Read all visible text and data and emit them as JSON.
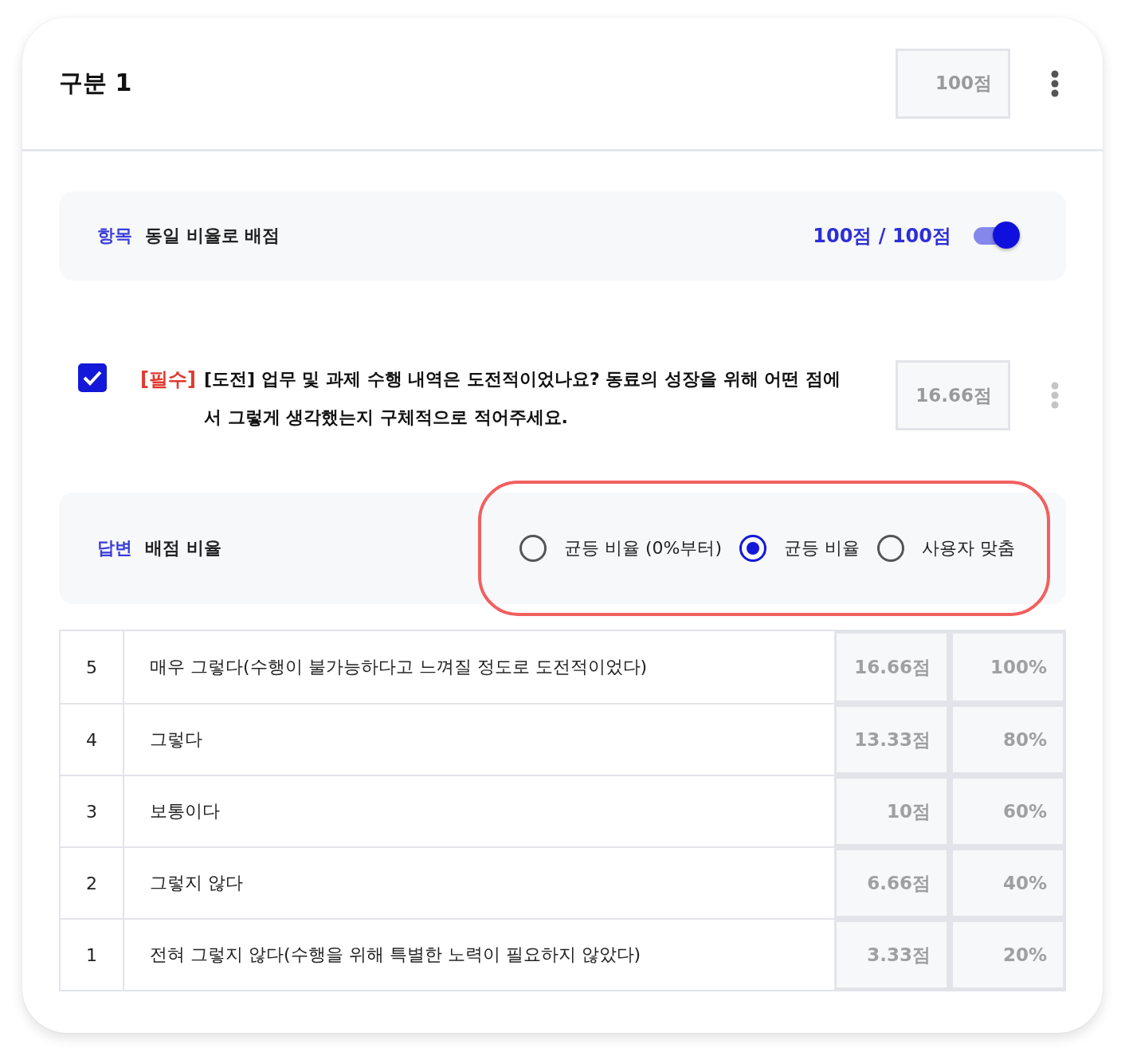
{
  "section": {
    "title": "구분 1",
    "score": "100점"
  },
  "item_bar": {
    "label": "항목",
    "title": "동일 비율로 배점",
    "total": "100점 / 100점",
    "toggle_on": true
  },
  "question": {
    "checked": true,
    "required_tag": "[필수]",
    "text": "[도전] 업무 및 과제 수행 내역은 도전적이었나요? 동료의 성장을 위해 어떤 점에서 그렇게 생각했는지 구체적으로 적어주세요.",
    "score": "16.66점"
  },
  "answer_bar": {
    "label": "답변",
    "title": "배점 비율",
    "highlighted": true,
    "options": [
      {
        "label": "균등 비율 (0%부터)",
        "selected": false
      },
      {
        "label": "균등 비율",
        "selected": true
      },
      {
        "label": "사용자 맞춤",
        "selected": false
      }
    ]
  },
  "rows": [
    {
      "number": "5",
      "text": "매우 그렇다(수행이 불가능하다고 느껴질 정도로 도전적이었다)",
      "score": "16.66점",
      "percent": "100%"
    },
    {
      "number": "4",
      "text": "그렇다",
      "score": "13.33점",
      "percent": "80%"
    },
    {
      "number": "3",
      "text": "보통이다",
      "score": "10점",
      "percent": "60%"
    },
    {
      "number": "2",
      "text": "그렇지 않다",
      "score": "6.66점",
      "percent": "40%"
    },
    {
      "number": "1",
      "text": "전혀 그렇지 않다(수행을 위해 특별한 노력이 필요하지 않았다)",
      "score": "3.33점",
      "percent": "20%"
    }
  ]
}
